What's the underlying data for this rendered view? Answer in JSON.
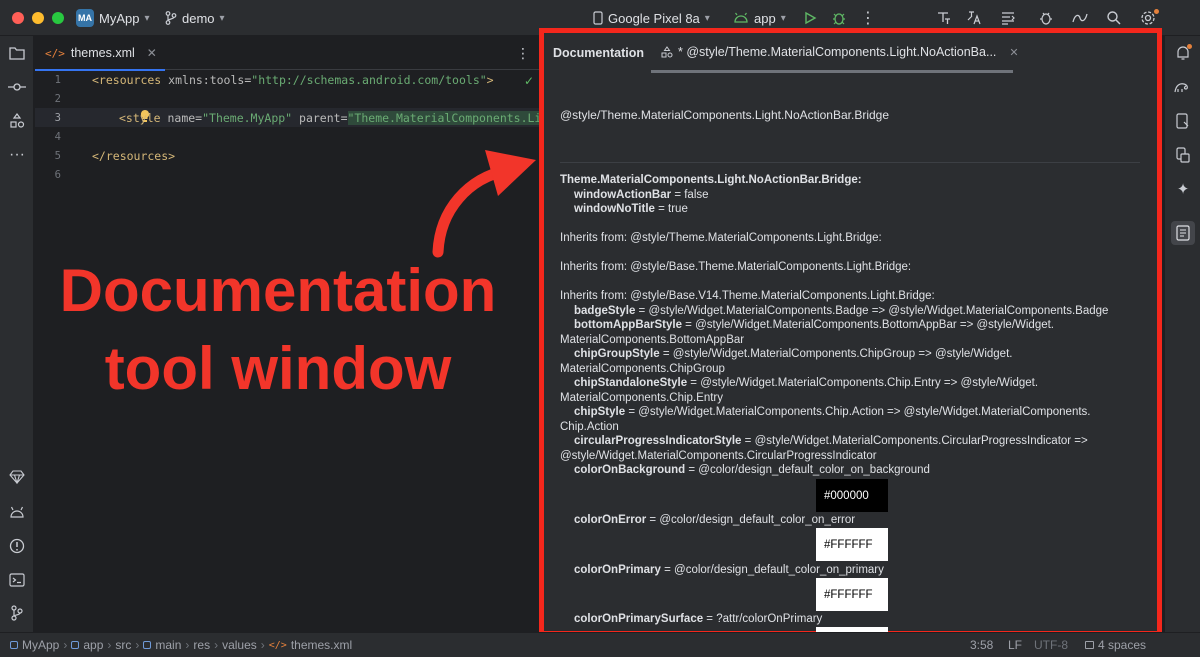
{
  "titlebar": {
    "project_badge": "MA",
    "project_name": "MyApp",
    "branch": "demo",
    "device": "Google Pixel 8a",
    "run_config": "app"
  },
  "editor": {
    "tab_label": "themes.xml",
    "line_numbers": [
      "1",
      "2",
      "3",
      "4",
      "5",
      "6"
    ],
    "code": {
      "l1_tag_open": "<resources",
      "l1_attr": " xmlns:tools=",
      "l1_str": "\"http://schemas.android.com/tools\"",
      "l1_tag_close": ">",
      "l3_tag_open": "<style",
      "l3_attr_name": " name=",
      "l3_str_name": "\"Theme.MyApp\"",
      "l3_attr_parent": " parent=",
      "l3_str_parent": "\"Theme.MaterialComponents.Light",
      "l5_tag": "</resources>"
    }
  },
  "annotation": {
    "line1": "Documentation",
    "line2": "tool window"
  },
  "doc": {
    "title": "Documentation",
    "tab_label": "* @style/Theme.MaterialComponents.Light.NoActionBa...",
    "reference": "@style/Theme.MaterialComponents.Light.NoActionBar.Bridge",
    "theme_header": "Theme.MaterialComponents.Light.NoActionBar.Bridge:",
    "items": [
      {
        "key": "windowActionBar",
        "val": " = false"
      },
      {
        "key": "windowNoTitle",
        "val": " = true"
      }
    ],
    "inherits1": "Inherits from: @style/Theme.MaterialComponents.Light.Bridge:",
    "inherits2": "Inherits from: @style/Base.Theme.MaterialComponents.Light.Bridge:",
    "inherits3": "Inherits from: @style/Base.V14.Theme.MaterialComponents.Light.Bridge:",
    "attrs": [
      {
        "key": "badgeStyle",
        "val": " = @style/Widget.MaterialComponents.Badge => @style/Widget.MaterialComponents.Badge"
      },
      {
        "key": "bottomAppBarStyle",
        "val": " = @style/Widget.MaterialComponents.BottomAppBar => @style/Widget.",
        "cont": "MaterialComponents.BottomAppBar"
      },
      {
        "key": "chipGroupStyle",
        "val": " = @style/Widget.MaterialComponents.ChipGroup => @style/Widget.",
        "cont": "MaterialComponents.ChipGroup"
      },
      {
        "key": "chipStandaloneStyle",
        "val": " = @style/Widget.MaterialComponents.Chip.Entry => @style/Widget.",
        "cont": "MaterialComponents.Chip.Entry"
      },
      {
        "key": "chipStyle",
        "val": " = @style/Widget.MaterialComponents.Chip.Action => @style/Widget.MaterialComponents.",
        "cont": "Chip.Action"
      },
      {
        "key": "circularProgressIndicatorStyle",
        "val": " = @style/Widget.MaterialComponents.CircularProgressIndicator =>",
        "cont": "@style/Widget.MaterialComponents.CircularProgressIndicator"
      },
      {
        "key": "colorOnBackground",
        "val": " = @color/design_default_color_on_background"
      },
      {
        "key": "colorOnError",
        "val": " = @color/design_default_color_on_error"
      },
      {
        "key": "colorOnPrimary",
        "val": " = @color/design_default_color_on_primary"
      },
      {
        "key": "colorOnPrimarySurface",
        "val": " = ?attr/colorOnPrimary"
      }
    ],
    "swatches": [
      {
        "label": "#000000",
        "color": "#000000",
        "text_color": "#ffffff"
      },
      {
        "label": "#FFFFFF",
        "color": "#ffffff",
        "text_color": "#000000"
      },
      {
        "label": "#FFFFFF",
        "color": "#ffffff",
        "text_color": "#000000"
      }
    ]
  },
  "statusbar": {
    "crumbs": [
      "MyApp",
      "app",
      "src",
      "main",
      "res",
      "values",
      "themes.xml"
    ],
    "position": "3:58",
    "line_sep": "LF",
    "encoding": "UTF-8",
    "indent": "4 spaces"
  },
  "colors": {
    "accent": "#3574f0",
    "highlight_frame": "#f4271c",
    "annotation_red": "#f2352a"
  }
}
